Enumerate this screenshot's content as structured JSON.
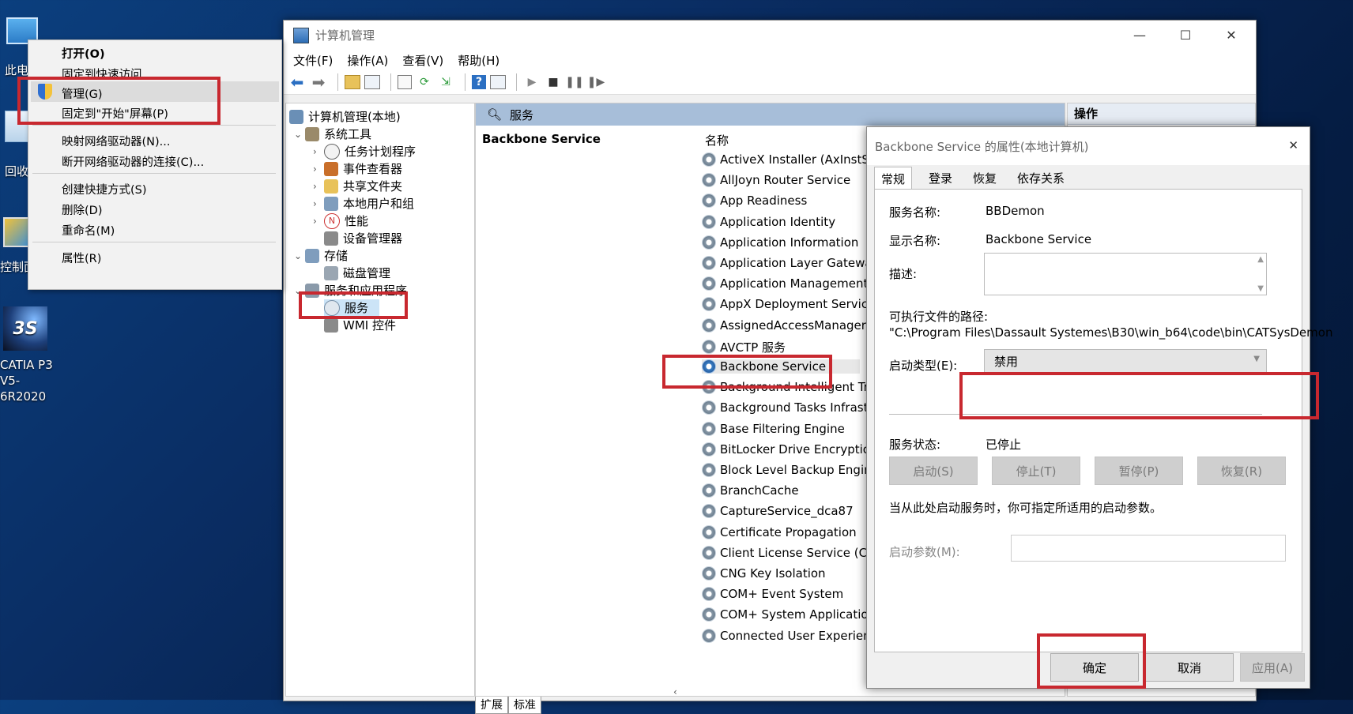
{
  "desktop": {
    "icons": [
      {
        "label": "此电"
      },
      {
        "label": "回收"
      },
      {
        "label": "控制面"
      },
      {
        "label": "CATIA P3\nV5-6R2020"
      }
    ]
  },
  "context_menu": {
    "items": [
      "打开(O)",
      "固定到快速访问",
      "管理(G)",
      "固定到\"开始\"屏幕(P)",
      "映射网络驱动器(N)...",
      "断开网络驱动器的连接(C)...",
      "创建快捷方式(S)",
      "删除(D)",
      "重命名(M)",
      "属性(R)"
    ]
  },
  "main_window": {
    "title": "计算机管理",
    "controls": {
      "minimize": "—",
      "maximize": "☐",
      "close": "✕"
    },
    "menu": [
      "文件(F)",
      "操作(A)",
      "查看(V)",
      "帮助(H)"
    ],
    "tree": {
      "root": "计算机管理(本地)",
      "system_tools": "系统工具",
      "task_scheduler": "任务计划程序",
      "event_viewer": "事件查看器",
      "shared_folders": "共享文件夹",
      "local_users": "本地用户和组",
      "performance": "性能",
      "device_manager": "设备管理器",
      "storage": "存储",
      "disk_management": "磁盘管理",
      "services_apps": "服务和应用程序",
      "services": "服务",
      "wmi": "WMI 控件"
    },
    "services_header": "服务",
    "selected_service_title": "Backbone Service",
    "column_name": "名称",
    "services": [
      "ActiveX Installer (AxInstSV)",
      "AllJoyn Router Service",
      "App Readiness",
      "Application Identity",
      "Application Information",
      "Application Layer Gateway ...",
      "Application Management",
      "AppX Deployment Service ...",
      "AssignedAccessManager ...",
      "AVCTP 服务",
      "Backbone Service",
      "Background Intelligent Tra...",
      "Background Tasks Infrastru...",
      "Base Filtering Engine",
      "BitLocker Drive Encryption ...",
      "Block Level Backup Engine ...",
      "BranchCache",
      "CaptureService_dca87",
      "Certificate Propagation",
      "Client License Service (Clip...",
      "CNG Key Isolation",
      "COM+ Event System",
      "COM+ System Application",
      "Connected User Experienc..."
    ],
    "bottom_tabs": [
      "扩展",
      "标准"
    ],
    "actions_header": "操作"
  },
  "dialog": {
    "title": "Backbone Service 的属性(本地计算机)",
    "close": "✕",
    "tabs": [
      "常规",
      "登录",
      "恢复",
      "依存关系"
    ],
    "service_name_label": "服务名称:",
    "service_name": "BBDemon",
    "display_name_label": "显示名称:",
    "display_name": "Backbone Service",
    "description_label": "描述:",
    "exe_path_label": "可执行文件的路径:",
    "exe_path": "\"C:\\Program Files\\Dassault Systemes\\B30\\win_b64\\code\\bin\\CATSysDemon",
    "startup_type_label": "启动类型(E):",
    "startup_type": "禁用",
    "service_status_label": "服务状态:",
    "service_status": "已停止",
    "btn_start": "启动(S)",
    "btn_stop": "停止(T)",
    "btn_pause": "暂停(P)",
    "btn_resume": "恢复(R)",
    "hint": "当从此处启动服务时，你可指定所适用的启动参数。",
    "start_params_label": "启动参数(M):",
    "ok": "确定",
    "cancel": "取消",
    "apply": "应用(A)"
  }
}
